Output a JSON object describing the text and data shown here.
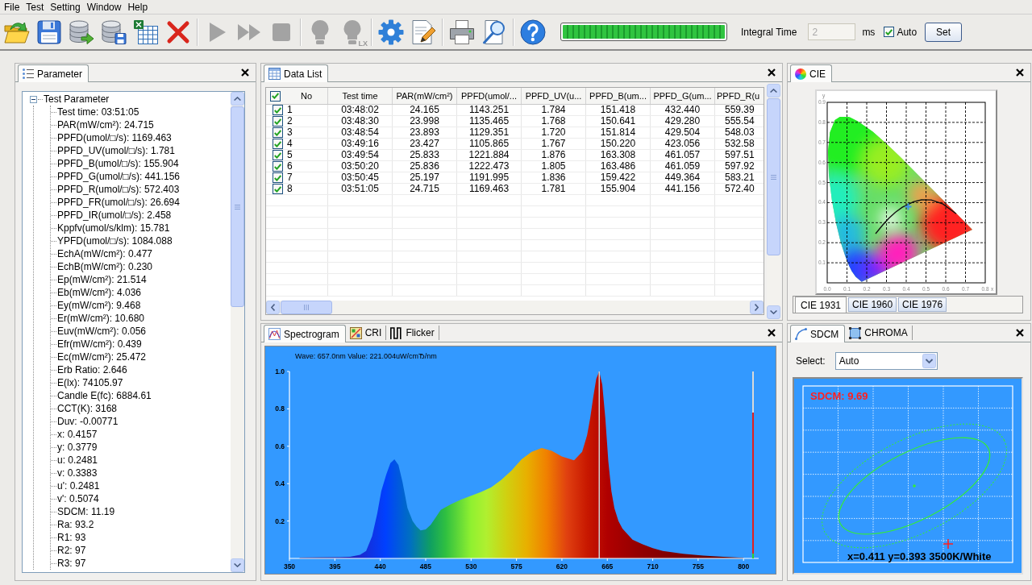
{
  "menu": [
    "File",
    "Test",
    "Setting",
    "Window",
    "Help"
  ],
  "toolbar": {
    "groups": [
      {
        "buttons": [
          {
            "kind": "open",
            "disabled": false
          },
          {
            "kind": "save",
            "disabled": false
          },
          {
            "kind": "export",
            "disabled": false
          },
          {
            "kind": "database-save",
            "disabled": false
          },
          {
            "kind": "spreadsheet",
            "disabled": false
          },
          {
            "kind": "delete",
            "disabled": false
          }
        ]
      },
      {
        "buttons": [
          {
            "kind": "play",
            "disabled": true
          },
          {
            "kind": "fast-forward",
            "disabled": true
          },
          {
            "kind": "stop",
            "disabled": true
          }
        ]
      },
      {
        "buttons": [
          {
            "kind": "bulb",
            "disabled": true
          },
          {
            "kind": "bulb",
            "disabled": true,
            "badge": "LX"
          }
        ]
      },
      {
        "buttons": [
          {
            "kind": "settings",
            "disabled": false
          },
          {
            "kind": "edit",
            "disabled": false
          }
        ]
      },
      {
        "buttons": [
          {
            "kind": "print",
            "disabled": false
          },
          {
            "kind": "preview",
            "disabled": false
          }
        ]
      },
      {
        "buttons": [
          {
            "kind": "help",
            "disabled": false
          }
        ]
      }
    ],
    "progress": {
      "level": 1
    },
    "integral_time": {
      "label": "Integral Time",
      "value": "2",
      "disabled": true,
      "unit": "ms"
    },
    "auto": {
      "label": "Auto",
      "checked": true
    },
    "set_button": {
      "label": "Set"
    }
  },
  "parameter_panel": {
    "tab": {
      "label": "Parameter",
      "selected": true
    },
    "tree": [
      {
        "label": "Test Parameter",
        "expanded": true,
        "children": [
          {
            "label": "Test time: 03:51:05"
          },
          {
            "label": "PAR(mW/cm²): 24.715"
          },
          {
            "label": "PPFD(umol/□/s): 1169.463"
          },
          {
            "label": "PPFD_UV(umol/□/s): 1.781"
          },
          {
            "label": "PPFD_B(umol/□/s): 155.904"
          },
          {
            "label": "PPFD_G(umol/□/s): 441.156"
          },
          {
            "label": "PPFD_R(umol/□/s): 572.403"
          },
          {
            "label": "PPFD_FR(umol/□/s): 26.694"
          },
          {
            "label": "PPFD_IR(umol/□/s): 2.458"
          },
          {
            "label": "Kppfv(umol/s/klm): 15.781"
          },
          {
            "label": "YPFD(umol/□/s): 1084.088"
          },
          {
            "label": "EchA(mW/cm²): 0.477"
          },
          {
            "label": "EchB(mW/cm²): 0.230"
          },
          {
            "label": "Ep(mW/cm²): 21.514"
          },
          {
            "label": "Eb(mW/cm²): 4.036"
          },
          {
            "label": "Ey(mW/cm²): 9.468"
          },
          {
            "label": "Er(mW/cm²): 10.680"
          },
          {
            "label": "Euv(mW/cm²): 0.056"
          },
          {
            "label": "Efr(mW/cm²): 0.439"
          },
          {
            "label": "Ec(mW/cm²): 25.472"
          },
          {
            "label": "Erb Ratio: 2.646"
          },
          {
            "label": "E(lx): 74105.97"
          },
          {
            "label": "Candle E(fc): 6884.61"
          },
          {
            "label": "CCT(K): 3168"
          },
          {
            "label": "Duv: -0.00771"
          },
          {
            "label": "x: 0.4157"
          },
          {
            "label": "y: 0.3779"
          },
          {
            "label": "u: 0.2481"
          },
          {
            "label": "v: 0.3383"
          },
          {
            "label": "u': 0.2481"
          },
          {
            "label": "v': 0.5074"
          },
          {
            "label": "SDCM: 11.19"
          },
          {
            "label": "Ra: 93.2"
          },
          {
            "label": "R1: 93"
          },
          {
            "label": "R2: 97"
          },
          {
            "label": "R3: 97"
          }
        ]
      }
    ]
  },
  "data_list_panel": {
    "tab": {
      "label": "Data List",
      "selected": true
    },
    "table": {
      "all_checked": true,
      "columns": [
        "No",
        "Test time",
        "PAR(mW/cm²)",
        "PPFD(umol/...",
        "PPFD_UV(u...",
        "PPFD_B(um...",
        "PPFD_G(um...",
        "PPFD_R(u"
      ],
      "rows": [
        {
          "checked": true,
          "cells": [
            "1",
            "03:48:02",
            "24.165",
            "1143.251",
            "1.784",
            "151.418",
            "432.440",
            "559.39"
          ]
        },
        {
          "checked": true,
          "cells": [
            "2",
            "03:48:30",
            "23.998",
            "1135.465",
            "1.768",
            "150.641",
            "429.280",
            "555.54"
          ]
        },
        {
          "checked": true,
          "cells": [
            "3",
            "03:48:54",
            "23.893",
            "1129.351",
            "1.720",
            "151.814",
            "429.504",
            "548.03"
          ]
        },
        {
          "checked": true,
          "cells": [
            "4",
            "03:49:16",
            "23.427",
            "1105.865",
            "1.767",
            "150.220",
            "423.056",
            "532.58"
          ]
        },
        {
          "checked": true,
          "cells": [
            "5",
            "03:49:54",
            "25.833",
            "1221.884",
            "1.876",
            "163.308",
            "461.057",
            "597.51"
          ]
        },
        {
          "checked": true,
          "cells": [
            "6",
            "03:50:20",
            "25.836",
            "1222.473",
            "1.805",
            "163.486",
            "461.059",
            "597.92"
          ]
        },
        {
          "checked": true,
          "cells": [
            "7",
            "03:50:45",
            "25.197",
            "1191.995",
            "1.836",
            "159.422",
            "449.364",
            "583.21"
          ]
        },
        {
          "checked": true,
          "cells": [
            "8",
            "03:51:05",
            "24.715",
            "1169.463",
            "1.781",
            "155.904",
            "441.156",
            "572.40"
          ]
        }
      ]
    }
  },
  "spectrum_panel": {
    "tabs": [
      {
        "label": "Spectrogram",
        "kind": "spectrum",
        "selected": true
      },
      {
        "label": "CRI",
        "kind": "cri",
        "selected": false
      },
      {
        "label": "Flicker",
        "kind": "flicker",
        "selected": false
      }
    ],
    "chart_data": {
      "type": "area",
      "title": "Wave: 657.0nm Value: 221.004uW/cmЂ/nm",
      "x": [
        360,
        380,
        400,
        410,
        420,
        426,
        432,
        437,
        441,
        446,
        450,
        454,
        458,
        462,
        467,
        472,
        476,
        480,
        485,
        490,
        495,
        500,
        510,
        520,
        530,
        540,
        550,
        560,
        570,
        580,
        590,
        600,
        610,
        620,
        632,
        640,
        645,
        648,
        651,
        654,
        657,
        660,
        663,
        666,
        669,
        672,
        676,
        680,
        690,
        700,
        710,
        720,
        740,
        760,
        780,
        800
      ],
      "values": [
        0.004,
        0.005,
        0.006,
        0.008,
        0.02,
        0.04,
        0.12,
        0.24,
        0.36,
        0.45,
        0.51,
        0.53,
        0.5,
        0.41,
        0.27,
        0.2,
        0.17,
        0.15,
        0.155,
        0.18,
        0.22,
        0.26,
        0.29,
        0.315,
        0.335,
        0.355,
        0.38,
        0.42,
        0.47,
        0.53,
        0.57,
        0.59,
        0.575,
        0.545,
        0.525,
        0.57,
        0.66,
        0.75,
        0.86,
        0.96,
        1.0,
        0.93,
        0.75,
        0.52,
        0.36,
        0.27,
        0.2,
        0.16,
        0.1,
        0.075,
        0.055,
        0.04,
        0.025,
        0.015,
        0.008,
        0.003
      ],
      "xlim": [
        350,
        815
      ],
      "ylim": [
        0,
        1
      ],
      "xticks": [
        350,
        395,
        440,
        485,
        530,
        575,
        620,
        665,
        710,
        755,
        800
      ],
      "yticks": [
        {
          "value": 0.2,
          "label": "0.2"
        },
        {
          "value": 0.4,
          "label": "0.4"
        },
        {
          "value": 0.6,
          "label": "0.6"
        },
        {
          "value": 0.8,
          "label": "0.8"
        },
        {
          "value": 1,
          "label": "1.0"
        }
      ],
      "ref_lines": [
        {
          "axis": "x",
          "value": 657
        }
      ]
    },
    "signal_meter": {
      "level": 0.78
    }
  },
  "cie_panel": {
    "tab": {
      "label": "CIE",
      "selected": true
    },
    "chart_data": {
      "type": "scatter",
      "xlabel": "x",
      "ylabel": "y",
      "x": [
        0.41
      ],
      "values": [
        0.38
      ],
      "xlim": [
        0,
        0.8
      ],
      "ylim": [
        0,
        0.9
      ],
      "grid": true,
      "xticks": [
        {
          "value": 0,
          "label": "0.0"
        },
        {
          "value": 0.1,
          "label": "0.1"
        },
        {
          "value": 0.2,
          "label": "0.2"
        },
        {
          "value": 0.3,
          "label": "0.3"
        },
        {
          "value": 0.4,
          "label": "0.4"
        },
        {
          "value": 0.5,
          "label": "0.5"
        },
        {
          "value": 0.6,
          "label": "0.6"
        },
        {
          "value": 0.7,
          "label": "0.7"
        },
        {
          "value": 0.8,
          "label": "0.8"
        }
      ],
      "yticks": [
        {
          "value": 0.1,
          "label": "0.1"
        },
        {
          "value": 0.2,
          "label": "0.2"
        },
        {
          "value": 0.3,
          "label": "0.3"
        },
        {
          "value": 0.4,
          "label": "0.4"
        },
        {
          "value": 0.5,
          "label": "0.5"
        },
        {
          "value": 0.6,
          "label": "0.6"
        },
        {
          "value": 0.7,
          "label": "0.7"
        },
        {
          "value": 0.8,
          "label": "0.8"
        },
        {
          "value": 0.9,
          "label": "0.9"
        }
      ]
    },
    "diagram_tabs": [
      {
        "label": "CIE 1931",
        "selected": true
      },
      {
        "label": "CIE 1960",
        "selected": false
      },
      {
        "label": "CIE 1976",
        "selected": false
      }
    ]
  },
  "sdcm_panel": {
    "tabs": [
      {
        "label": "SDCM",
        "kind": "sdcm",
        "selected": true
      },
      {
        "label": "CHROMA",
        "kind": "chroma",
        "selected": false
      }
    ],
    "select": {
      "label": "Select:",
      "value": "Auto"
    },
    "plot": {
      "sdcm": "SDCM: 9.69",
      "readout": "x=0.411 y=0.393 3500K/White"
    }
  }
}
